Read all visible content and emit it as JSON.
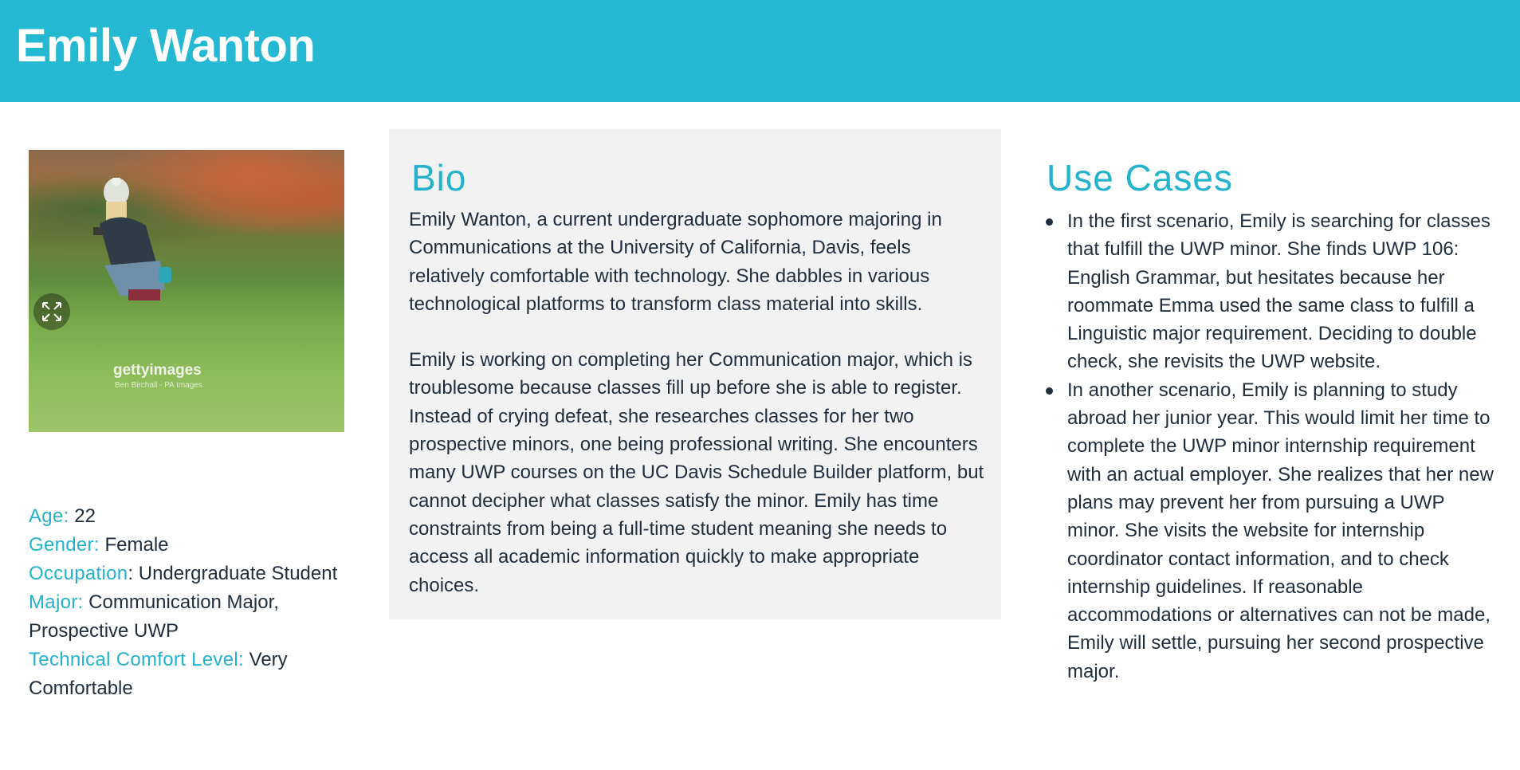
{
  "header": {
    "title": "Emily Wanton"
  },
  "photo": {
    "watermark": "gettyimages",
    "credit": "Ben Birchall - PA Images"
  },
  "details": [
    {
      "label": "Age:",
      "value": " 22"
    },
    {
      "label": "Gender:",
      "value": " Female"
    },
    {
      "label": "Occupation",
      "value": ": Undergraduate Student"
    },
    {
      "label": "Major:",
      "value": " Communication Major, Prospective UWP"
    },
    {
      "label": "Technical Comfort Level:",
      "value": " Very Comfortable"
    }
  ],
  "bio": {
    "title": "Bio",
    "paragraphs": [
      "Emily Wanton, a current undergraduate sophomore majoring in Communications at the University of California, Davis, feels relatively comfortable with technology. She dabbles in various technological platforms to transform class material into skills.",
      "Emily is working on completing her Communication major, which is troublesome because classes fill up before she is able to register. Instead of crying defeat, she researches classes for her two prospective minors, one being professional writing. She encounters many UWP courses on the UC Davis Schedule Builder platform, but cannot decipher what classes satisfy the minor. Emily has time constraints from being a full-time student meaning she needs to access all academic information quickly to make appropriate choices."
    ]
  },
  "use_cases": {
    "title": "Use Cases",
    "items": [
      "In the first scenario, Emily is searching for classes that fulfill the UWP minor. She finds UWP 106: English Grammar, but hesitates because her roommate Emma used the same class to fulfill a Linguistic major requirement. Deciding to double check, she revisits the UWP website.",
      "In another scenario, Emily is planning to study abroad her junior year. This would limit her time to complete the UWP minor internship requirement with an actual employer. She realizes that her new plans may prevent her from pursuing a UWP minor. She visits the website for internship coordinator contact information, and to check internship guidelines. If reasonable accommodations or alternatives can not be made, Emily will settle, pursuing her second prospective major."
    ]
  },
  "colors": {
    "header_bg": "#24b8d2",
    "accent": "#24b2cc",
    "text": "#1f2d3d",
    "bio_bg": "#f2f2f2"
  }
}
